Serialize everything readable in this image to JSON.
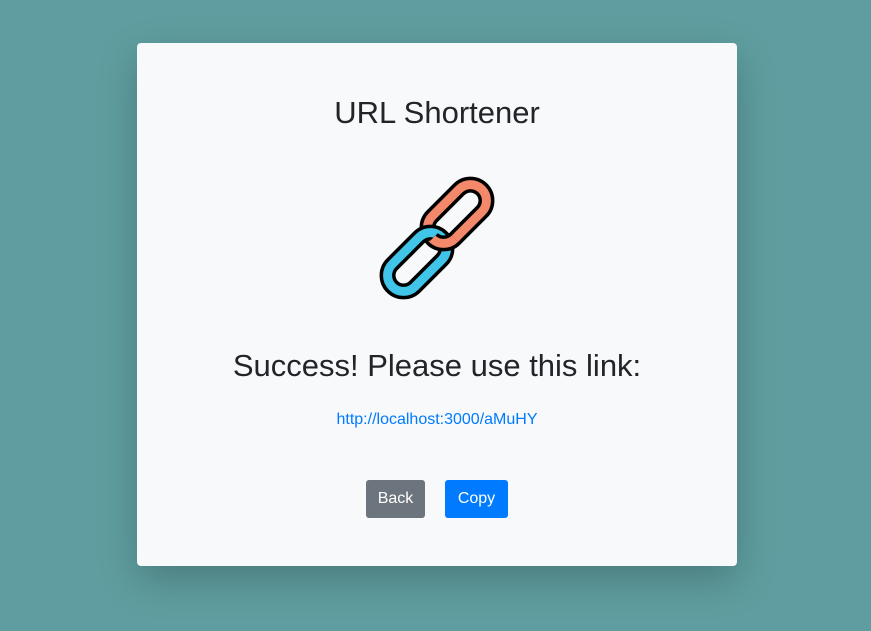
{
  "app": {
    "title": "URL Shortener"
  },
  "icon": {
    "name": "link-chain-icon",
    "colors": {
      "orange_link": "#f4886a",
      "blue_link": "#40c4e8",
      "outline": "#000000"
    }
  },
  "result": {
    "message": "Success! Please use this link:",
    "short_url": "http://localhost:3000/aMuHY"
  },
  "actions": {
    "back_label": "Back",
    "copy_label": "Copy"
  },
  "colors": {
    "background": "#5f9ea0",
    "card": "#f8f9fa",
    "link": "#007bff",
    "back_button": "#6c757d",
    "copy_button": "#007bff"
  }
}
